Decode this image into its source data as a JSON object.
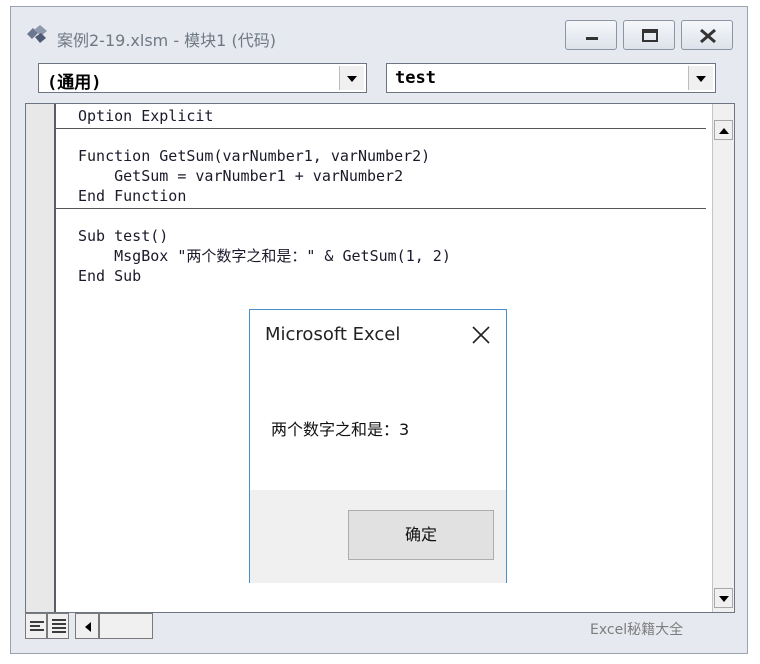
{
  "window": {
    "title": "案例2-19.xlsm - 模块1 (代码)",
    "icon": "vba-module-icon"
  },
  "toolbar": {
    "object_combo": "(通用)",
    "procedure_combo": "test"
  },
  "code": {
    "lines": [
      "Option Explicit",
      "",
      "Function GetSum(varNumber1, varNumber2)",
      "    GetSum = varNumber1 + varNumber2",
      "End Function",
      "",
      "Sub test()",
      "    MsgBox \"两个数字之和是：\" & GetSum(1, 2)",
      "End Sub"
    ]
  },
  "dialog": {
    "title": "Microsoft Excel",
    "message": "两个数字之和是：3",
    "ok_label": "确定"
  },
  "watermark": "Excel秘籍大全",
  "colors": {
    "dialog_border": "#4b8fc9",
    "editor_bg": "#ffffff",
    "window_bg": "#e6e9ef"
  }
}
